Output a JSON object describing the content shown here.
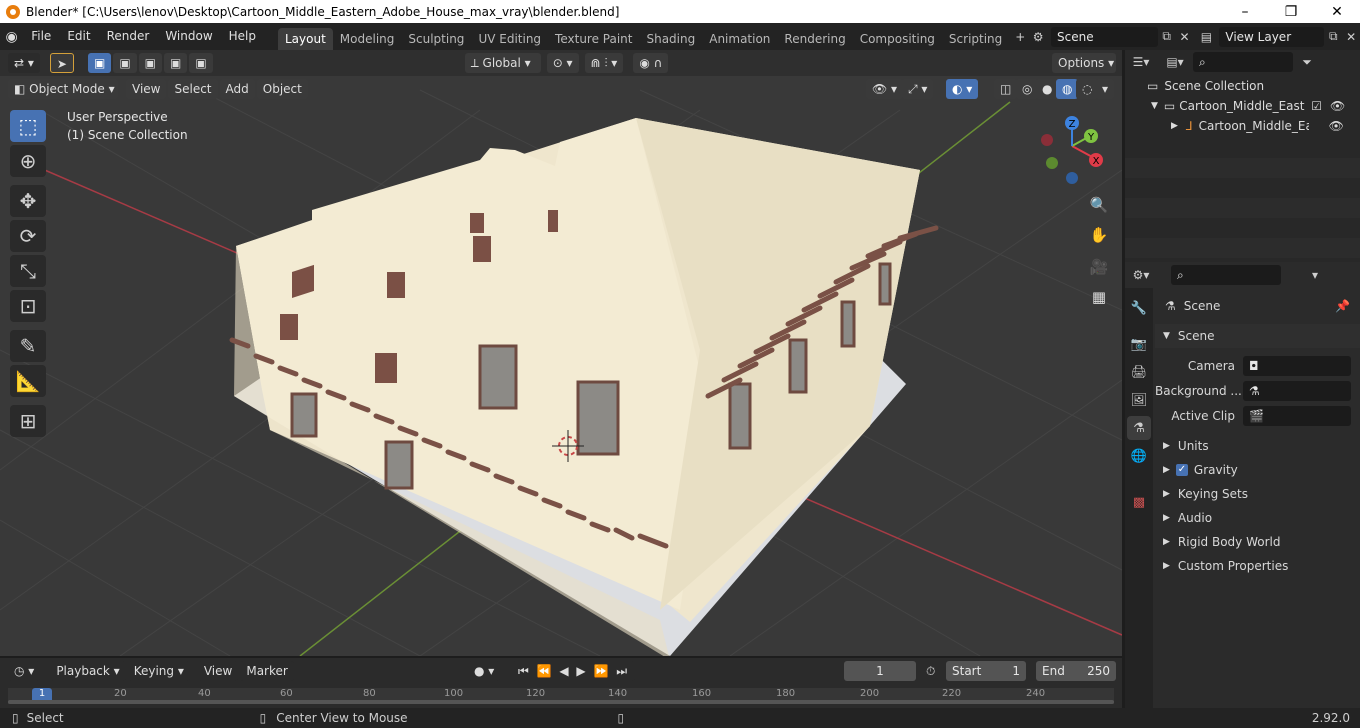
{
  "window": {
    "title": "Blender* [C:\\Users\\lenov\\Desktop\\Cartoon_Middle_Eastern_Adobe_House_max_vray\\blender.blend]",
    "minimize": "–",
    "maximize": "❐",
    "close": "✕"
  },
  "menubar": {
    "menus": [
      "File",
      "Edit",
      "Render",
      "Window",
      "Help"
    ],
    "workspaces": [
      "Layout",
      "Modeling",
      "Sculpting",
      "UV Editing",
      "Texture Paint",
      "Shading",
      "Animation",
      "Rendering",
      "Compositing",
      "Scripting"
    ],
    "active_workspace": "Layout",
    "scene_name": "Scene",
    "view_layer_name": "View Layer"
  },
  "viewport": {
    "transform_orientation": "Global",
    "options_label": "Options",
    "mode": "Object Mode",
    "header_menus": [
      "View",
      "Select",
      "Add",
      "Object"
    ],
    "overlay_text_1": "User Perspective",
    "overlay_text_2": "(1) Scene Collection",
    "gizmo": {
      "x": "X",
      "y": "Y",
      "z": "Z"
    }
  },
  "outliner": {
    "root": "Scene Collection",
    "collection": "Cartoon_Middle_Eastern_",
    "object": "Cartoon_Middle_East"
  },
  "properties": {
    "context": "Scene",
    "panel": "Scene",
    "camera_label": "Camera",
    "background_label": "Background ...",
    "active_clip_label": "Active Clip",
    "sections": [
      "Units",
      "Gravity",
      "Keying Sets",
      "Audio",
      "Rigid Body World",
      "Custom Properties"
    ],
    "gravity_enabled": true
  },
  "timeline": {
    "menus": [
      "Playback",
      "Keying",
      "View",
      "Marker"
    ],
    "current_frame": "1",
    "start_label": "Start",
    "start_value": "1",
    "end_label": "End",
    "end_value": "250",
    "ruler": [
      "1",
      "20",
      "40",
      "60",
      "80",
      "100",
      "120",
      "140",
      "160",
      "180",
      "200",
      "220",
      "240"
    ]
  },
  "statusbar": {
    "left": "Select",
    "middle": "Center View to Mouse",
    "version": "2.92.0"
  },
  "colors": {
    "accent": "#4772b3",
    "axis_x": "#e03b48",
    "axis_y": "#7fc341",
    "axis_z": "#3d83e0",
    "wall": "#f1e8d0",
    "base": "#d8dade"
  }
}
